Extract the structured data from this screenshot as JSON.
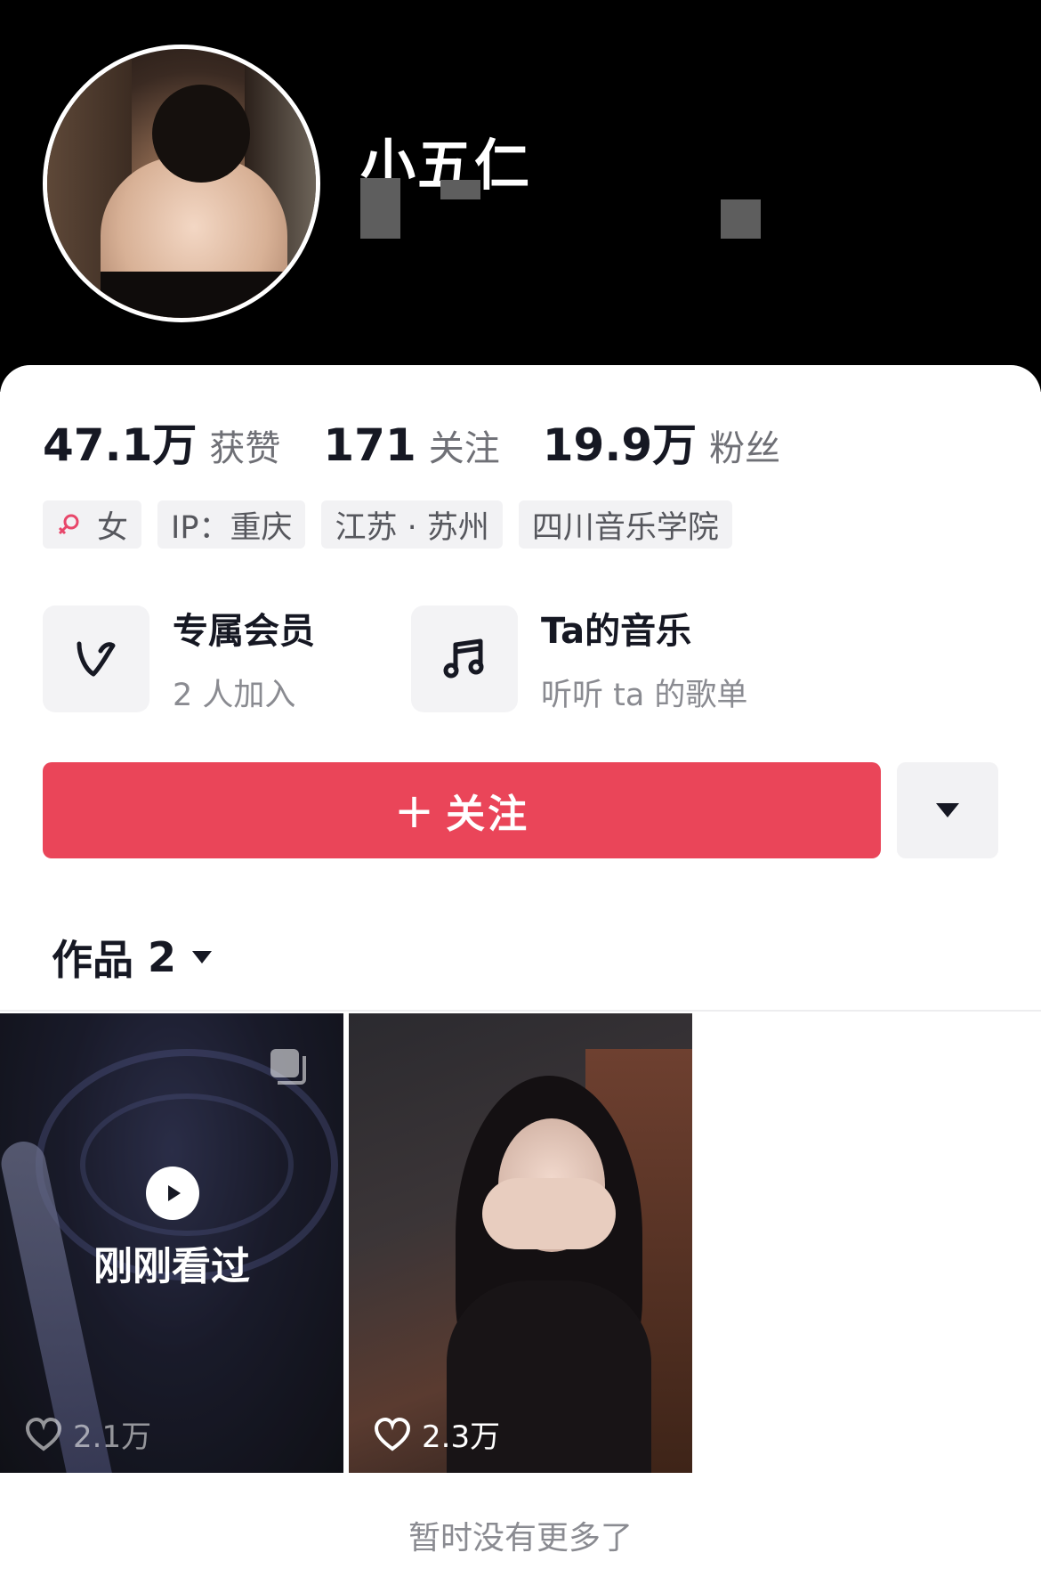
{
  "profile": {
    "name": "小五仁"
  },
  "stats": [
    {
      "value": "47.1万",
      "label": "获赞"
    },
    {
      "value": "171",
      "label": "关注"
    },
    {
      "value": "19.9万",
      "label": "粉丝"
    }
  ],
  "tags": {
    "gender": "女",
    "ip": "IP：重庆",
    "location": "江苏 · 苏州",
    "school": "四川音乐学院"
  },
  "features": [
    {
      "title": "专属会员",
      "subtitle": "2 人加入",
      "icon": "membership-v-icon"
    },
    {
      "title": "Ta的音乐",
      "subtitle": "听听 ta 的歌单",
      "icon": "music-note-icon"
    }
  ],
  "actions": {
    "follow_label": "关注",
    "follow_plus": "+"
  },
  "works": {
    "tab_label": "作品",
    "count": "2",
    "items": [
      {
        "overlay": "刚刚看过",
        "likes": "2.1万"
      },
      {
        "likes": "2.3万"
      }
    ],
    "footer": "暂时没有更多了"
  },
  "colors": {
    "accent": "#ea4559",
    "header_bg": "#000000",
    "female_icon": "#e8476a"
  }
}
